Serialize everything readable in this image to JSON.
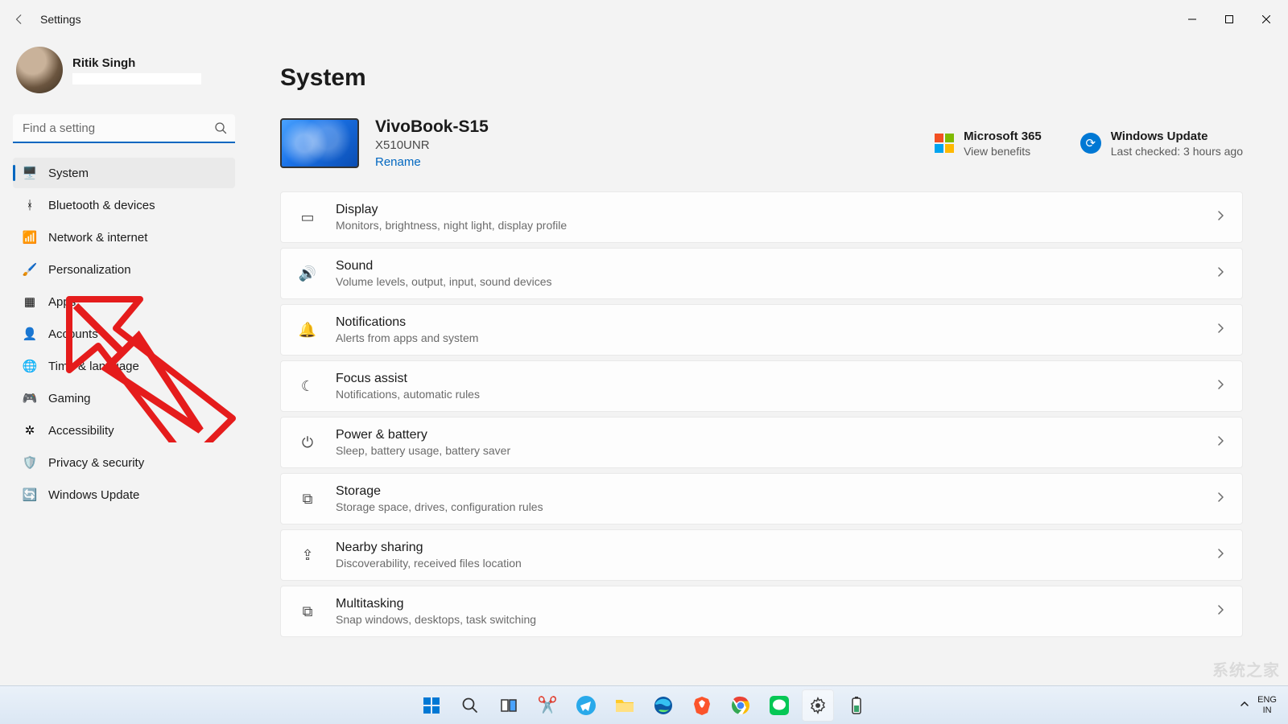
{
  "window": {
    "title": "Settings"
  },
  "user": {
    "name": "Ritik Singh"
  },
  "search": {
    "placeholder": "Find a setting"
  },
  "nav": [
    {
      "id": "system",
      "label": "System",
      "icon": "🖥️",
      "active": true
    },
    {
      "id": "bluetooth",
      "label": "Bluetooth & devices",
      "icon": "ᚼ",
      "active": false
    },
    {
      "id": "network",
      "label": "Network & internet",
      "icon": "📶",
      "active": false
    },
    {
      "id": "personalization",
      "label": "Personalization",
      "icon": "🖌️",
      "active": false
    },
    {
      "id": "apps",
      "label": "Apps",
      "icon": "▦",
      "active": false
    },
    {
      "id": "accounts",
      "label": "Accounts",
      "icon": "👤",
      "active": false
    },
    {
      "id": "time",
      "label": "Time & language",
      "icon": "🌐",
      "active": false
    },
    {
      "id": "gaming",
      "label": "Gaming",
      "icon": "🎮",
      "active": false
    },
    {
      "id": "accessibility",
      "label": "Accessibility",
      "icon": "✲",
      "active": false
    },
    {
      "id": "privacy",
      "label": "Privacy & security",
      "icon": "🛡️",
      "active": false
    },
    {
      "id": "update",
      "label": "Windows Update",
      "icon": "🔄",
      "active": false
    }
  ],
  "page": {
    "title": "System"
  },
  "device": {
    "name": "VivoBook-S15",
    "model": "X510UNR",
    "rename": "Rename"
  },
  "ms365": {
    "title": "Microsoft 365",
    "sub": "View benefits"
  },
  "wupdate": {
    "title": "Windows Update",
    "sub": "Last checked: 3 hours ago"
  },
  "cards": [
    {
      "id": "display",
      "title": "Display",
      "sub": "Monitors, brightness, night light, display profile",
      "icon": "▭"
    },
    {
      "id": "sound",
      "title": "Sound",
      "sub": "Volume levels, output, input, sound devices",
      "icon": "🔊"
    },
    {
      "id": "notifications",
      "title": "Notifications",
      "sub": "Alerts from apps and system",
      "icon": "🔔"
    },
    {
      "id": "focus",
      "title": "Focus assist",
      "sub": "Notifications, automatic rules",
      "icon": "☾"
    },
    {
      "id": "power",
      "title": "Power & battery",
      "sub": "Sleep, battery usage, battery saver",
      "icon": "⏻"
    },
    {
      "id": "storage",
      "title": "Storage",
      "sub": "Storage space, drives, configuration rules",
      "icon": "⧉"
    },
    {
      "id": "nearby",
      "title": "Nearby sharing",
      "sub": "Discoverability, received files location",
      "icon": "⇪"
    },
    {
      "id": "multitask",
      "title": "Multitasking",
      "sub": "Snap windows, desktops, task switching",
      "icon": "⧉"
    }
  ],
  "taskbar": {
    "lang1": "ENG",
    "lang2": "IN"
  },
  "watermark": "系统之家"
}
